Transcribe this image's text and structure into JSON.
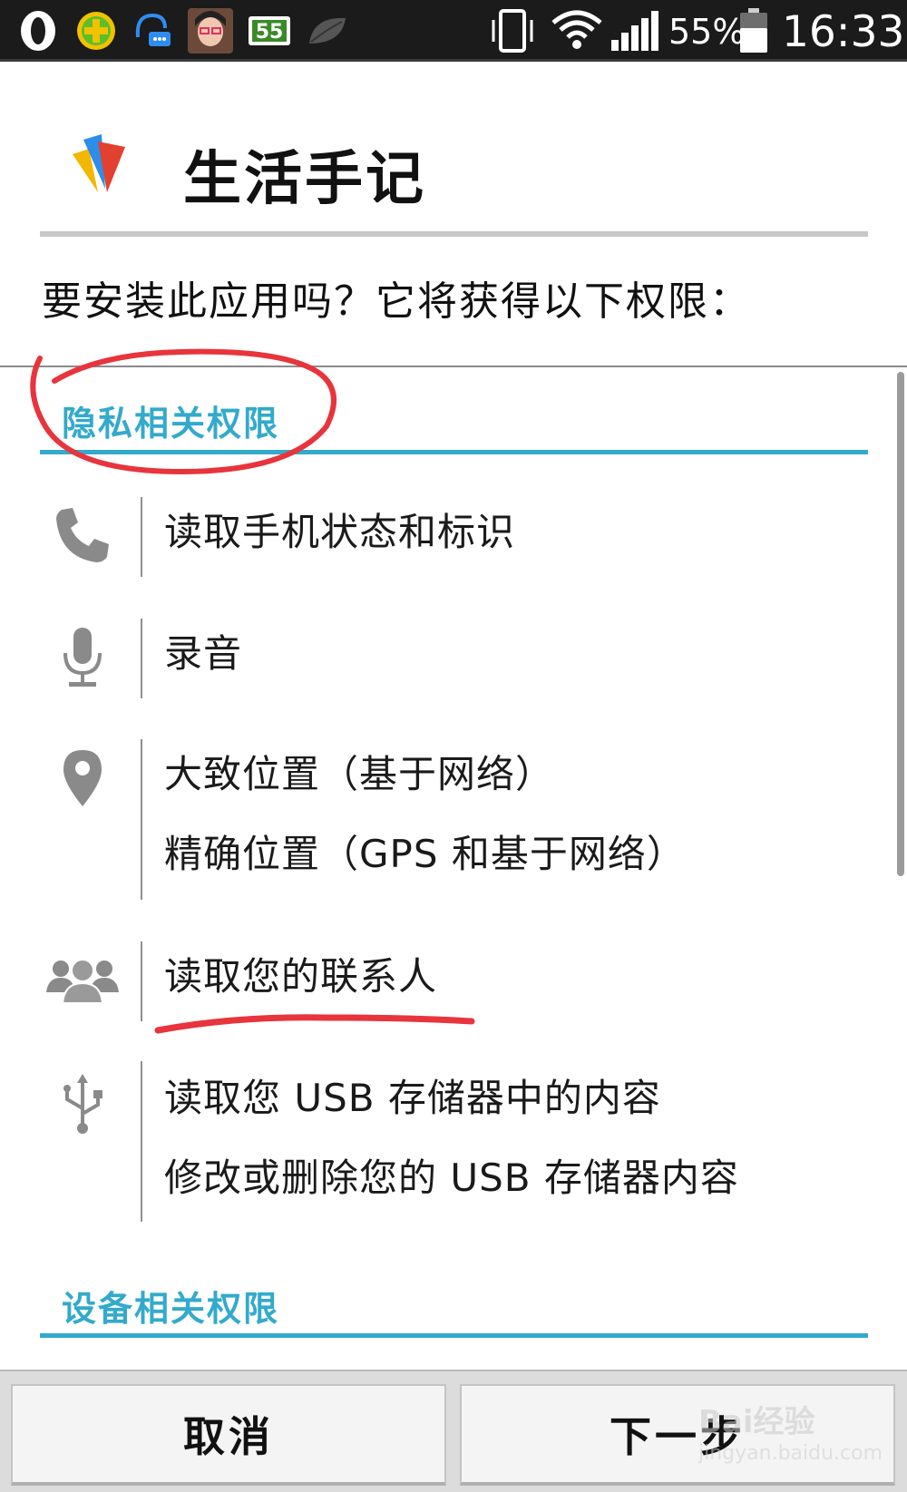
{
  "status_bar": {
    "battery_percent": "55%",
    "time": "16:33",
    "icons": [
      "opera-icon",
      "360-security-icon",
      "chat-bubble-icon",
      "contact-avatar-icon",
      "55-app-icon",
      "leaf-icon",
      "vibrate-icon",
      "wifi-icon",
      "cell-signal-icon",
      "battery-icon"
    ]
  },
  "app": {
    "name": "生活手记",
    "icon": "app-logo-icon"
  },
  "prompt": {
    "question": "要安装此应用吗？它将获得以下权限："
  },
  "permissions": {
    "privacy_section": {
      "title": "隐私相关权限",
      "groups": [
        {
          "icon": "phone-icon",
          "items": [
            "读取手机状态和标识"
          ]
        },
        {
          "icon": "microphone-icon",
          "items": [
            "录音"
          ]
        },
        {
          "icon": "location-pin-icon",
          "items": [
            "大致位置（基于网络）",
            "精确位置（GPS 和基于网络）"
          ]
        },
        {
          "icon": "contacts-icon",
          "items": [
            "读取您的联系人"
          ]
        },
        {
          "icon": "usb-icon",
          "items": [
            "读取您 USB 存储器中的内容",
            "修改或删除您的 USB 存储器内容"
          ]
        }
      ]
    },
    "device_section": {
      "title": "设备相关权限"
    }
  },
  "buttons": {
    "cancel": "取消",
    "next": "下一步"
  },
  "watermark": {
    "brand": "Bai经验",
    "url": "jingyan.baidu.com"
  },
  "colors": {
    "accent": "#33aacb",
    "annotation_red": "#e8343c",
    "status_bar_bg": "#1b1b1b"
  }
}
